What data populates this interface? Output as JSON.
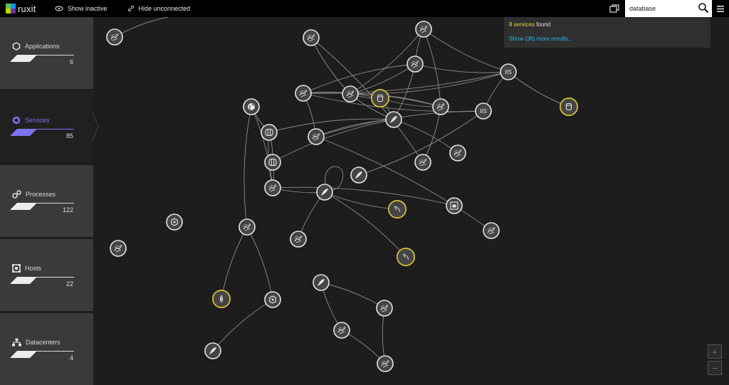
{
  "app": {
    "logo_text": "ruxit",
    "accent_color": "#7c73f0",
    "highlight_color": "#d8c23a"
  },
  "toolbar": {
    "show_inactive_label": "Show inactive",
    "hide_unconnected_label": "Hide unconnected"
  },
  "search": {
    "value": "database",
    "results_count": "8 services",
    "results_suffix": " found",
    "show_more": "Show (38) more results..."
  },
  "sidebar": {
    "items": [
      {
        "label": "Applications",
        "count": "6",
        "icon": "hexagon-icon"
      },
      {
        "label": "Services",
        "count": "85",
        "icon": "gear-icon"
      },
      {
        "label": "Processes",
        "count": "122",
        "icon": "processes-icon"
      },
      {
        "label": "Hosts",
        "count": "22",
        "icon": "hosts-icon"
      },
      {
        "label": "Datacenters",
        "count": "4",
        "icon": "datacenter-icon"
      }
    ]
  },
  "map": {
    "nodes": [
      {
        "id": "n1",
        "icon": "web-service-icon"
      },
      {
        "id": "n2",
        "icon": "web-service-icon"
      },
      {
        "id": "n3",
        "icon": "web-service-icon"
      },
      {
        "id": "n4",
        "icon": "web-service-icon"
      },
      {
        "id": "n5",
        "icon": "iis-icon",
        "label": "IIS"
      },
      {
        "id": "n6",
        "icon": "database-icon",
        "highlighted": true
      },
      {
        "id": "n7",
        "icon": "database-icon",
        "highlighted": true
      },
      {
        "id": "n8",
        "icon": "web-service-icon"
      },
      {
        "id": "n9",
        "icon": "web-service-icon"
      },
      {
        "id": "n10",
        "icon": "globe-icon"
      },
      {
        "id": "n11",
        "icon": "web-service-icon"
      },
      {
        "id": "n12",
        "icon": "iis-icon",
        "label": "IIS"
      },
      {
        "id": "n13",
        "icon": "feather-icon"
      },
      {
        "id": "n14",
        "icon": "database-cluster-icon"
      },
      {
        "id": "n15",
        "icon": "web-service-icon"
      },
      {
        "id": "n16",
        "icon": "database-cluster-icon"
      },
      {
        "id": "n17",
        "icon": "web-service-icon"
      },
      {
        "id": "n18",
        "icon": "web-service-icon"
      },
      {
        "id": "n19",
        "icon": "web-service-icon"
      },
      {
        "id": "n20",
        "icon": "feather-icon"
      },
      {
        "id": "n21",
        "icon": "mysql-dolphin-icon",
        "highlighted": true
      },
      {
        "id": "n22",
        "icon": "feather-icon"
      },
      {
        "id": "n23",
        "icon": "hosts-service-icon"
      },
      {
        "id": "n24",
        "icon": "nodejs-icon"
      },
      {
        "id": "n25",
        "icon": "web-service-icon"
      },
      {
        "id": "n26",
        "icon": "web-service-icon"
      },
      {
        "id": "n27",
        "icon": "web-service-icon"
      },
      {
        "id": "n28",
        "icon": "mysql-dolphin-icon",
        "highlighted": true
      },
      {
        "id": "n29",
        "icon": "web-service-icon"
      },
      {
        "id": "n30",
        "icon": "feather-icon"
      },
      {
        "id": "n31",
        "icon": "web-service-icon"
      },
      {
        "id": "n32",
        "icon": "mongodb-leaf-icon",
        "highlighted": true
      },
      {
        "id": "n33",
        "icon": "nodejs-icon"
      },
      {
        "id": "n34",
        "icon": "web-service-icon"
      },
      {
        "id": "n35",
        "icon": "feather-icon"
      },
      {
        "id": "n36",
        "icon": "web-service-icon"
      }
    ],
    "edges": [
      [
        "n1",
        "edge-off-top"
      ],
      [
        "n3",
        "n4"
      ],
      [
        "n3",
        "n8"
      ],
      [
        "n3",
        "n5"
      ],
      [
        "n3",
        "n9"
      ],
      [
        "n4",
        "n5"
      ],
      [
        "n4",
        "n8"
      ],
      [
        "n4",
        "n11"
      ],
      [
        "n4",
        "n13"
      ],
      [
        "n5",
        "n7"
      ],
      [
        "n5",
        "n11"
      ],
      [
        "n5",
        "n12"
      ],
      [
        "n5",
        "n8"
      ],
      [
        "n2",
        "n8"
      ],
      [
        "n2",
        "n17"
      ],
      [
        "n8",
        "n6"
      ],
      [
        "n8",
        "n9"
      ],
      [
        "n8",
        "n13"
      ],
      [
        "n9",
        "n6"
      ],
      [
        "n9",
        "n11"
      ],
      [
        "n9",
        "n17"
      ],
      [
        "n6",
        "n11"
      ],
      [
        "n6",
        "n13"
      ],
      [
        "n11",
        "n12"
      ],
      [
        "n11",
        "n15"
      ],
      [
        "n12",
        "n15"
      ],
      [
        "n12",
        "n22"
      ],
      [
        "n10",
        "n14"
      ],
      [
        "n10",
        "n19"
      ],
      [
        "n10",
        "n25"
      ],
      [
        "n14",
        "n13"
      ],
      [
        "n14",
        "n19"
      ],
      [
        "n14",
        "n16"
      ],
      [
        "n13",
        "n16"
      ],
      [
        "n13",
        "n18"
      ],
      [
        "n13",
        "n15"
      ],
      [
        "n16",
        "n19"
      ],
      [
        "n19",
        "n20"
      ],
      [
        "n19",
        "n23"
      ],
      [
        "n20",
        "n21"
      ],
      [
        "n20",
        "n28"
      ],
      [
        "n20",
        "n26"
      ],
      [
        "n15",
        "n27"
      ],
      [
        "n25",
        "n32"
      ],
      [
        "n25",
        "n33"
      ],
      [
        "n33",
        "n35"
      ],
      [
        "n30",
        "n31"
      ],
      [
        "n30",
        "n34"
      ],
      [
        "n34",
        "n36"
      ],
      [
        "n31",
        "n36"
      ]
    ]
  }
}
